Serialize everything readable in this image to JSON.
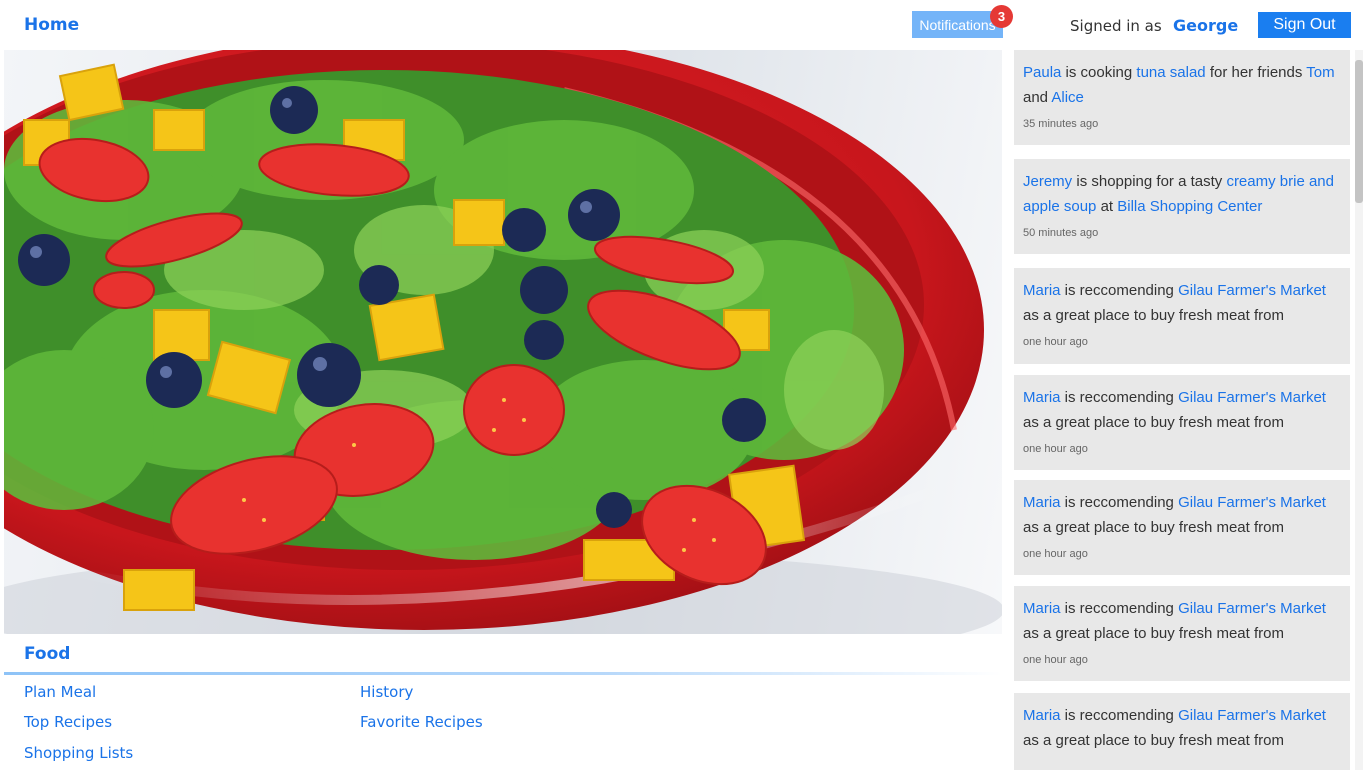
{
  "header": {
    "home": "Home",
    "notifications_label": "Notifications",
    "notifications_count": "3",
    "signed_in_prefix": "Signed in as",
    "username": "George",
    "sign_out": "Sign Out"
  },
  "food": {
    "title": "Food",
    "links": [
      "Plan Meal",
      "History",
      "Top Recipes",
      "Favorite Recipes",
      "Shopping Lists"
    ]
  },
  "feed": [
    {
      "parts": [
        "Paula",
        " is cooking ",
        "tuna salad",
        " for her friends ",
        "Tom",
        " and ",
        "Alice"
      ],
      "time": "35 minutes ago"
    },
    {
      "parts": [
        "Jeremy",
        " is shopping for a tasty ",
        "creamy brie and apple soup",
        " at ",
        "Billa Shopping Center"
      ],
      "time": "50 minutes ago"
    },
    {
      "parts": [
        "Maria",
        " is reccomending ",
        "Gilau Farmer's Market",
        " as a great place to buy fresh meat from"
      ],
      "time": "one hour ago"
    },
    {
      "parts": [
        "Maria",
        " is reccomending ",
        "Gilau Farmer's Market",
        " as a great place to buy fresh meat from"
      ],
      "time": "one hour ago"
    },
    {
      "parts": [
        "Maria",
        " is reccomending ",
        "Gilau Farmer's Market",
        " as a great place to buy fresh meat from"
      ],
      "time": "one hour ago"
    },
    {
      "parts": [
        "Maria",
        " is reccomending ",
        "Gilau Farmer's Market",
        " as a great place to buy fresh meat from"
      ],
      "time": "one hour ago"
    },
    {
      "parts": [
        "Maria",
        " is reccomending ",
        "Gilau Farmer's Market",
        " as a great place to buy fresh meat from"
      ],
      "time": ""
    }
  ],
  "colors": {
    "accent": "#1a73e8",
    "notification_bg": "#74b4f8",
    "badge": "#e53935",
    "signout_bg": "#1a7ef0",
    "card_bg": "#e8e8e8"
  },
  "icons": {
    "hero": "salad-bowl-image"
  }
}
